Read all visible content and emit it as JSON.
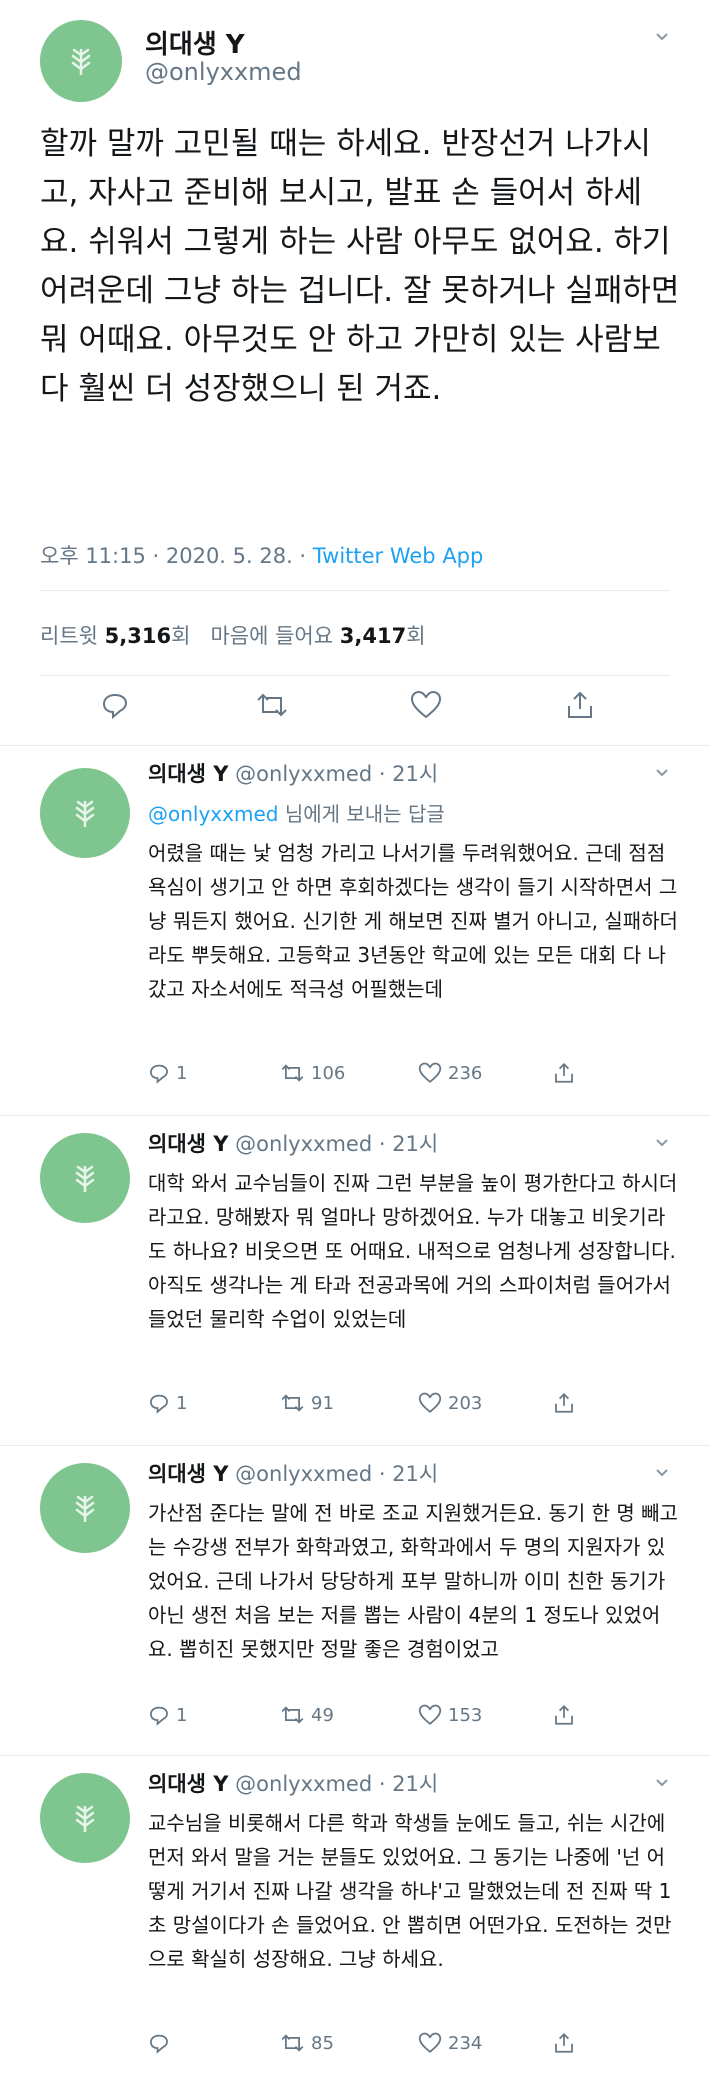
{
  "main_tweet": {
    "name": "의대생 Y",
    "handle": "@onlyxxmed",
    "text": "할까 말까 고민될 때는 하세요. 반장선거 나가시고, 자사고 준비해 보시고, 발표 손 들어서 하세요. 쉬워서 그렇게 하는 사람 아무도 없어요. 하기 어려운데 그냥 하는 겁니다. 잘 못하거나 실패하면 뭐 어때요. 아무것도 안 하고 가만히 있는 사람보다 훨씬 더 성장했으니 된 거죠.",
    "time": "오후 11:15 · 2020. 5. 28. · ",
    "client": "Twitter Web App",
    "retweets_label": "리트윗",
    "retweets_count": "5,316",
    "count_suffix": "회",
    "likes_label": "마음에 들어요",
    "likes_count": "3,417",
    "likes_suffix": "회"
  },
  "replies": [
    {
      "name": "의대생 Y",
      "handle": "@onlyxxmed · 21시",
      "reply_to_mention": "@onlyxxmed",
      "reply_to_rest": " 님에게 보내는 답글",
      "text": "어렸을 때는 낯 엄청 가리고 나서기를 두려워했어요. 근데 점점 욕심이 생기고 안 하면 후회하겠다는 생각이 들기 시작하면서 그냥 뭐든지 했어요. 신기한 게 해보면 진짜 별거 아니고, 실패하더라도 뿌듯해요. 고등학교 3년동안 학교에 있는 모든 대회 다 나갔고 자소서에도 적극성 어필했는데",
      "replies": "1",
      "retweets": "106",
      "likes": "236"
    },
    {
      "name": "의대생 Y",
      "handle": "@onlyxxmed · 21시",
      "text": "대학 와서 교수님들이 진짜 그런 부분을 높이 평가한다고 하시더라고요. 망해봤자 뭐 얼마나 망하겠어요. 누가 대놓고 비웃기라도 하나요? 비웃으면 또 어때요. 내적으로 엄청나게 성장합니다. 아직도 생각나는 게 타과 전공과목에 거의 스파이처럼 들어가서 들었던 물리학 수업이 있었는데",
      "replies": "1",
      "retweets": "91",
      "likes": "203"
    },
    {
      "name": "의대생 Y",
      "handle": "@onlyxxmed · 21시",
      "text": "가산점 준다는 말에 전 바로 조교 지원했거든요. 동기 한 명 빼고는 수강생 전부가 화학과였고, 화학과에서 두 명의 지원자가 있었어요. 근데 나가서 당당하게 포부 말하니까 이미 친한 동기가 아닌 생전 처음 보는 저를 뽑는 사람이 4분의 1 정도나 있었어요. 뽑히진 못했지만 정말 좋은 경험이었고",
      "replies": "1",
      "retweets": "49",
      "likes": "153"
    },
    {
      "name": "의대생 Y",
      "handle": "@onlyxxmed · 21시",
      "text": "교수님을 비롯해서 다른 학과 학생들 눈에도 들고, 쉬는 시간에 먼저 와서 말을 거는 분들도 있었어요. 그 동기는 나중에 '넌 어떻게 거기서 진짜 나갈 생각을 하냐'고 말했었는데 전 진짜 딱 1초 망설이다가 손 들었어요. 안 뽑히면 어떤가요. 도전하는 것만으로 확실히 성장해요. 그냥 하세요.",
      "replies": "",
      "retweets": "85",
      "likes": "234"
    }
  ],
  "colors": {
    "avatar": "#7fc58f",
    "link": "#1da1f2",
    "muted": "#657786"
  }
}
